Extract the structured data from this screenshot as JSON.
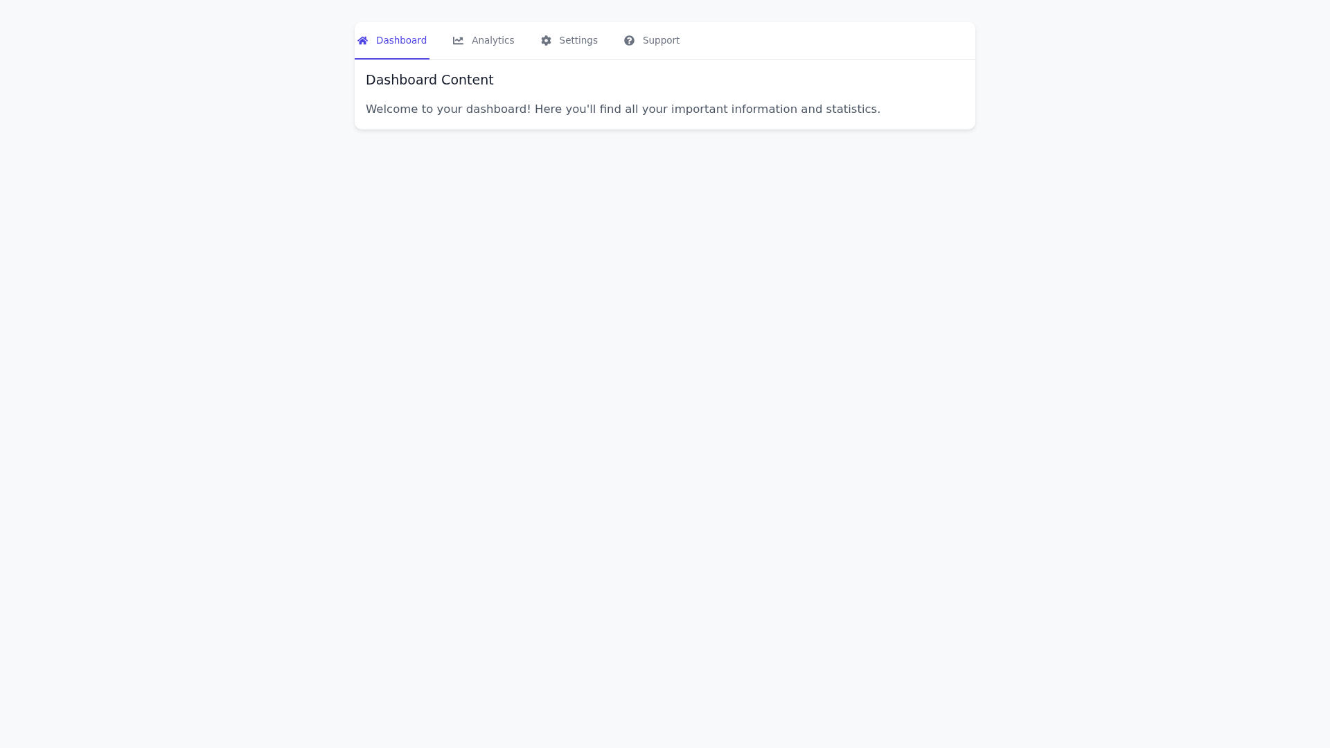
{
  "tabs": [
    {
      "label": "Dashboard",
      "selected": true
    },
    {
      "label": "Analytics",
      "selected": false
    },
    {
      "label": "Settings",
      "selected": false
    },
    {
      "label": "Support",
      "selected": false
    }
  ],
  "content": {
    "title": "Dashboard Content",
    "text": "Welcome to your dashboard! Here you'll find all your important information and statistics."
  }
}
